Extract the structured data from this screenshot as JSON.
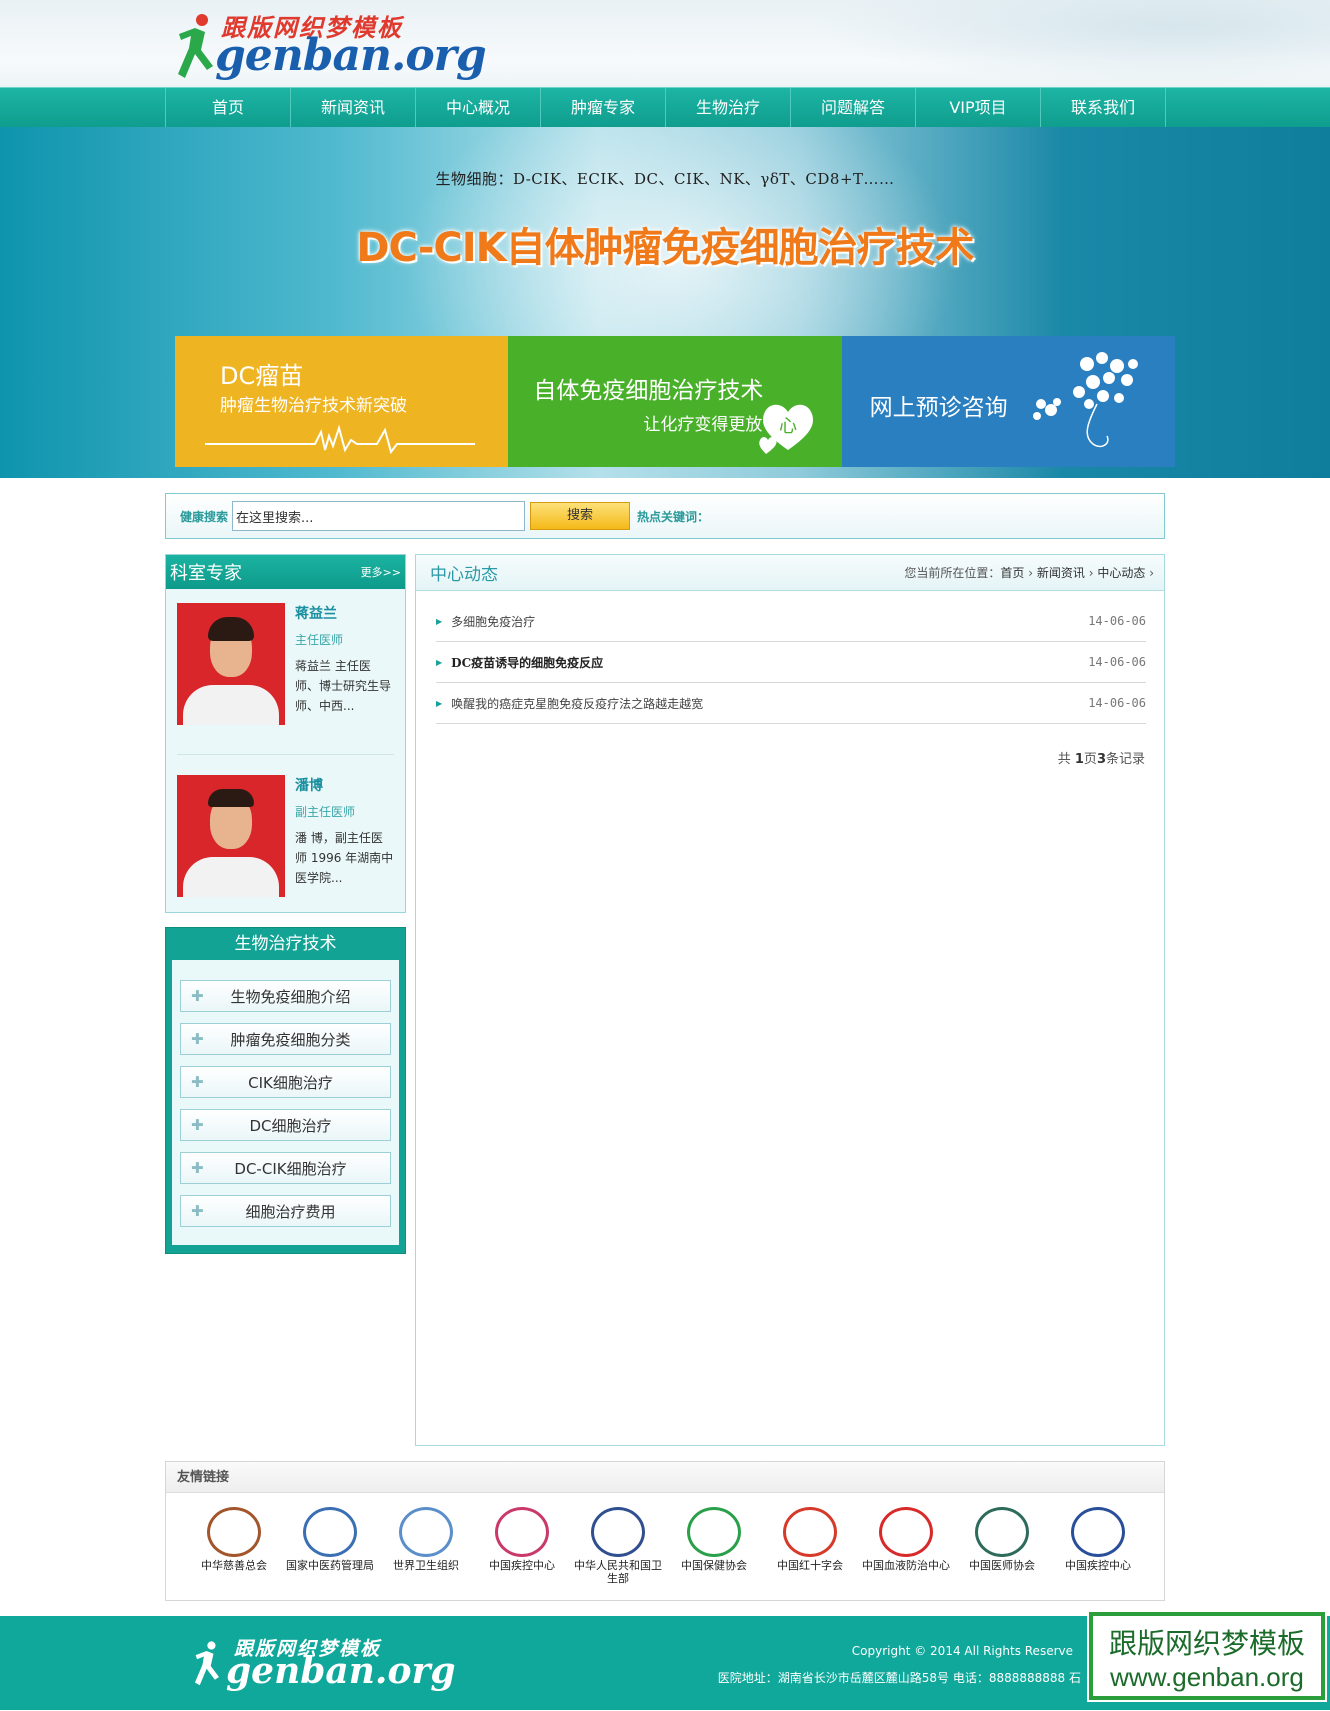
{
  "logo": {
    "cn": "跟版网织梦模板",
    "en": "genban.org"
  },
  "nav": [
    "首页",
    "新闻资讯",
    "中心概况",
    "肿瘤专家",
    "生物治疗",
    "问题解答",
    "VIP项目",
    "联系我们"
  ],
  "banner": {
    "subtitle": "生物细胞：D-CIK、ECIK、DC、CIK、NK、γδT、CD8+T……",
    "headline": "DC-CIK自体肿瘤免疫细胞治疗技术",
    "tiles": [
      {
        "title": "DC瘤苗",
        "sub": "肿瘤生物治疗技术新突破",
        "color": "#eeb422"
      },
      {
        "title": "自体免疫细胞治疗技术",
        "sub": "让化疗变得更放",
        "heart": "心",
        "color": "#49b02a"
      },
      {
        "title": "网上预诊咨询",
        "color": "#2a7fc1"
      }
    ]
  },
  "search": {
    "label": "健康搜索",
    "value": "在这里搜索...",
    "button": "搜索",
    "hot": "热点关键词："
  },
  "experts": {
    "title": "科室专家",
    "more": "更多>>",
    "items": [
      {
        "name": "蒋益兰",
        "role": "主任医师",
        "desc": "蒋益兰 主任医师、博士研究生导师、中西..."
      },
      {
        "name": "潘博",
        "role": "副主任医师",
        "desc": "潘 博，副主任医师 1996 年湖南中医学院..."
      }
    ]
  },
  "tech": {
    "title": "生物治疗技术",
    "items": [
      "生物免疫细胞介绍",
      "肿瘤免疫细胞分类",
      "CIK细胞治疗",
      "DC细胞治疗",
      "DC-CIK细胞治疗",
      "细胞治疗费用"
    ]
  },
  "main": {
    "title": "中心动态",
    "crumb_label": "您当前所在位置：",
    "crumbs": [
      "首页",
      "新闻资讯",
      "中心动态"
    ],
    "articles": [
      {
        "title": "多细胞免疫治疗",
        "date": "14-06-06"
      },
      {
        "title": "DC疫苗诱导的细胞免疫反应",
        "date": "14-06-06"
      },
      {
        "title": "唤醒我的癌症克星胞免疫反疫疗法之路越走越宽",
        "date": "14-06-06"
      }
    ],
    "pager": {
      "pre": "共 ",
      "pages": "1",
      "mid": "页",
      "count": "3",
      "post": "条记录"
    }
  },
  "links": {
    "title": "友情链接",
    "items": [
      {
        "name": "中华慈善总会",
        "color": "#a3552b"
      },
      {
        "name": "国家中医药管理局",
        "color": "#3a6fb3"
      },
      {
        "name": "世界卫生组织",
        "color": "#5b8fc9"
      },
      {
        "name": "中国疾控中心",
        "color": "#c93a6b"
      },
      {
        "name": "中华人民共和国卫生部",
        "color": "#2f4f8f"
      },
      {
        "name": "中国保健协会",
        "color": "#2aa04a"
      },
      {
        "name": "中国红十字会",
        "color": "#d63a2a"
      },
      {
        "name": "中国血液防治中心",
        "color": "#d82a2a"
      },
      {
        "name": "中国医师协会",
        "color": "#2e6b5a"
      },
      {
        "name": "中国疾控中心",
        "color": "#2a4f9a"
      }
    ]
  },
  "footer": {
    "copyright": "Copyright © 2014 All Rights Reserve",
    "address": "医院地址：湖南省长沙市岳麓区麓山路58号 电话：8888888888 石",
    "watermark_cn": "跟版网织梦模板",
    "watermark_en": "www.genban.org"
  },
  "colors": {
    "teal": "#0fa89b",
    "accent_blue": "#2a9aa6",
    "orange": "#f07a1a"
  }
}
